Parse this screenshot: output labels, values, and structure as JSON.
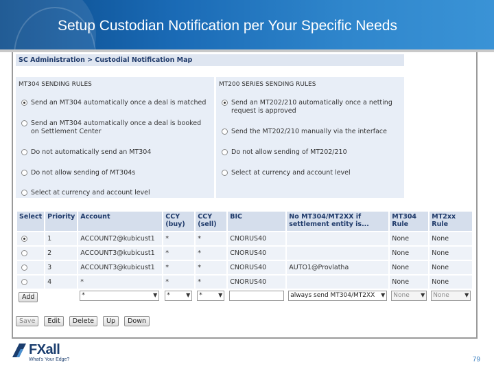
{
  "slide": {
    "title": "Setup Custodian Notification per Your Specific Needs",
    "page_number": "79",
    "logo_text": "FXall",
    "logo_tagline": "What's Your Edge?"
  },
  "breadcrumb": "SC Administration  >  Custodial Notification Map",
  "mt304_rules": {
    "title": "MT304 SENDING RULES",
    "options": [
      {
        "label": "Send an MT304 automatically once a deal is matched",
        "selected": true
      },
      {
        "label": "Send an MT304 automatically once a deal is booked on Settlement Center",
        "selected": false
      },
      {
        "label": "Do not automatically send an MT304",
        "selected": false
      },
      {
        "label": "Do not allow sending of MT304s",
        "selected": false
      },
      {
        "label": "Select at currency and account level",
        "selected": false
      }
    ]
  },
  "mt200_rules": {
    "title": "MT200 SERIES SENDING RULES",
    "options": [
      {
        "label": "Send an MT202/210 automatically once a netting request is approved",
        "selected": true
      },
      {
        "label": "Send the MT202/210 manually via the interface",
        "selected": false
      },
      {
        "label": "Do not allow sending of MT202/210",
        "selected": false
      },
      {
        "label": "Select at currency and account level",
        "selected": false
      }
    ]
  },
  "table": {
    "headers": [
      "Select",
      "Priority",
      "Account",
      "CCY (buy)",
      "CCY (sell)",
      "BIC",
      "No MT304/MT2XX if settlement entity is...",
      "MT304 Rule",
      "MT2xx Rule"
    ],
    "rows": [
      {
        "selected": true,
        "priority": "1",
        "account": "ACCOUNT2@kubicust1",
        "ccy_buy": "*",
        "ccy_sell": "*",
        "bic": "CNORUS40",
        "no_mt_entity": "",
        "mt304_rule": "None",
        "mt2xx_rule": "None"
      },
      {
        "selected": false,
        "priority": "2",
        "account": "ACCOUNT3@kubicust1",
        "ccy_buy": "*",
        "ccy_sell": "*",
        "bic": "CNORUS40",
        "no_mt_entity": "",
        "mt304_rule": "None",
        "mt2xx_rule": "None"
      },
      {
        "selected": false,
        "priority": "3",
        "account": "ACCOUNT3@kubicust1",
        "ccy_buy": "*",
        "ccy_sell": "*",
        "bic": "CNORUS40",
        "no_mt_entity": "AUTO1@Provlatha",
        "mt304_rule": "None",
        "mt2xx_rule": "None"
      },
      {
        "selected": false,
        "priority": "4",
        "account": "*",
        "ccy_buy": "*",
        "ccy_sell": "*",
        "bic": "CNORUS40",
        "no_mt_entity": "",
        "mt304_rule": "None",
        "mt2xx_rule": "None"
      }
    ],
    "input_row": {
      "add_label": "Add",
      "account": "*",
      "ccy_buy": "*",
      "ccy_sell": "*",
      "bic": "",
      "no_mt_entity": "always send MT304/MT2XX",
      "mt304_rule": "None",
      "mt2xx_rule": "None"
    }
  },
  "actions": {
    "save": "Save",
    "edit": "Edit",
    "delete": "Delete",
    "up": "Up",
    "down": "Down"
  },
  "colors": {
    "header_blue": "#1a6ab5",
    "panel_bg": "#e8eef7",
    "table_header_bg": "#d5deec"
  }
}
